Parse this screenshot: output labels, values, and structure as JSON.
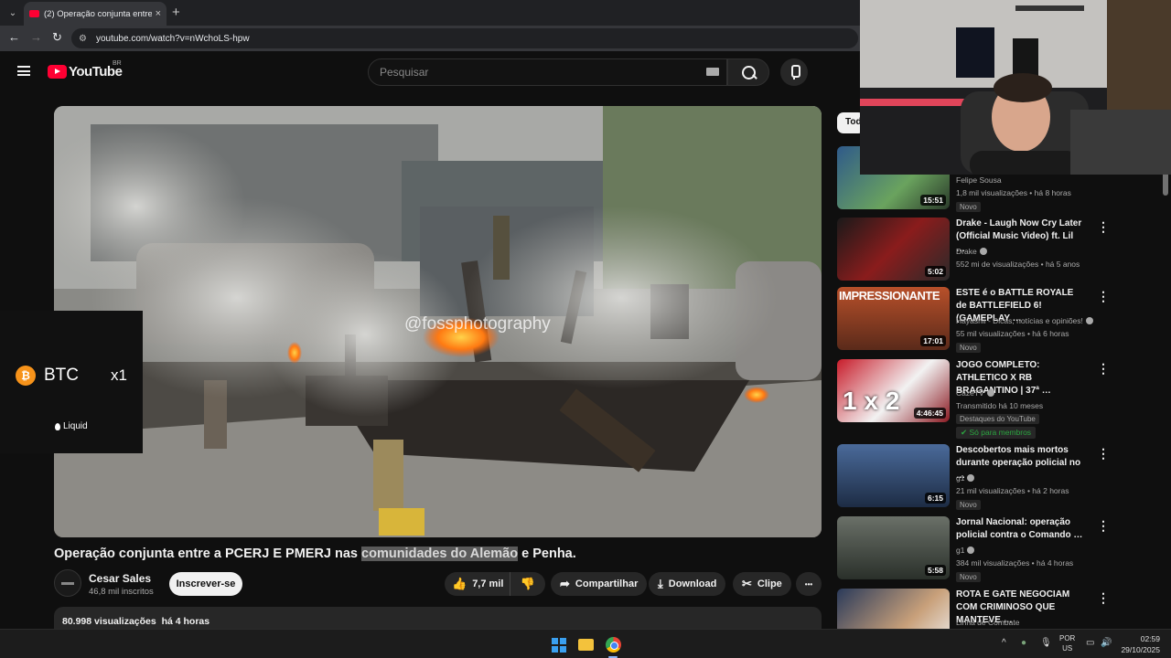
{
  "browser": {
    "tab_title": "(2) Operação conjunta entre a P",
    "tab_close": "×",
    "new_tab": "+",
    "url": "youtube.com/watch?v=nWchoLS-hpw",
    "back": "←",
    "forward": "→",
    "reload": "↻",
    "tab_menu": "⌄"
  },
  "header": {
    "logo_text": "YouTube",
    "region": "BR",
    "search_placeholder": "Pesquisar"
  },
  "player": {
    "watermark": "@fossphotography",
    "ad": {
      "symbol": "BTC",
      "multiplier": "x1",
      "brand": "Liquid",
      "coin_glyph": "₿"
    }
  },
  "video": {
    "title_before": "Operação conjunta entre a PCERJ E PMERJ nas ",
    "title_highlight": "comunidades do Alemão",
    "title_after": " e Penha.",
    "channel": "Cesar Sales",
    "subscribers": "46,8 mil inscritos",
    "subscribe_label": "Inscrever-se",
    "likes": "7,7 mil",
    "share_label": "Compartilhar",
    "download_label": "Download",
    "clip_label": "Clipe",
    "more": "•••",
    "views": "80.998 visualizações",
    "age": "há 4 horas"
  },
  "sidebar": {
    "chip": "Todos",
    "items": [
      {
        "title": "",
        "channel": "Felipe Sousa",
        "meta": "1,8 mil visualizações • há 8 horas",
        "badge": "Novo",
        "duration": "15:51",
        "thumb_color": "#3a6a40"
      },
      {
        "title": "Drake - Laugh Now Cry Later (Official Music Video) ft. Lil …",
        "channel": "Drake",
        "meta": "552 mi de visualizações • há 5 anos",
        "badge": "",
        "duration": "5:02",
        "thumb_color": "#7a1a1a"
      },
      {
        "title": "ESTE é o BATTLE ROYALE de BATTLEFIELD 6! (GAMEPLAY …",
        "channel": "Hayashii - Dicas, notícias e opiniões!",
        "meta": "55 mil visualizações • há 6 horas",
        "badge": "Novo",
        "duration": "17:01",
        "thumb_color": "#a24a14",
        "thumb_text": "IMPRESSIONANTE"
      },
      {
        "title": "JOGO COMPLETO: ATHLETICO X RB BRAGANTINO | 37ª …",
        "channel": "CazéTV",
        "meta": "Transmitido há 10 meses",
        "badge": "Destaques do YouTube",
        "members": "Só para membros",
        "duration": "4:46:45",
        "thumb_color": "#8a1a22",
        "thumb_text": "1 x 2"
      },
      {
        "title": "Descobertos mais mortos durante operação policial no …",
        "channel": "g1",
        "meta": "21 mil visualizações • há 2 horas",
        "badge": "Novo",
        "duration": "6:15",
        "thumb_color": "#2f4c70"
      },
      {
        "title": "Jornal Nacional: operação policial contra o Comando …",
        "channel": "g1",
        "meta": "384 mil visualizações • há 4 horas",
        "badge": "Novo",
        "duration": "5:58",
        "thumb_color": "#3d4a3a"
      },
      {
        "title": "ROTA E GATE NEGOCIAM COM CRIMINOSO QUE MANTEVE …",
        "channel": "Linha de Combate",
        "meta": "",
        "badge": "",
        "duration": "",
        "thumb_color": "#24304a"
      }
    ]
  },
  "taskbar": {
    "lang_top": "POR",
    "lang_bottom": "US",
    "time": "02:59",
    "date": "29/10/2025",
    "chevron": "^"
  }
}
